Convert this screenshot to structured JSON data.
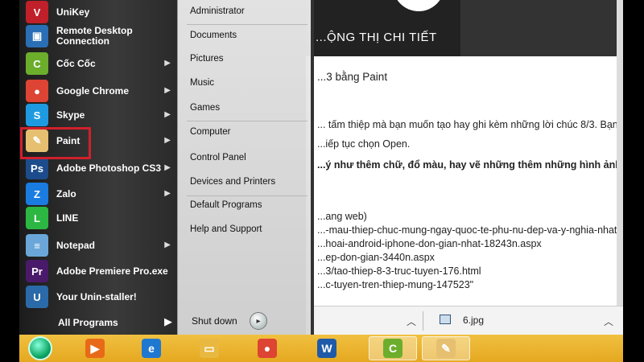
{
  "document": {
    "header_text": "...ỘNG THỊ CHI TIẾT",
    "lines": [
      "...3 bằng Paint",
      "... tấm thiệp mà bạn muốn tạo hay ghi kèm những lời chúc 8/3. Bạn",
      "...iếp tục chọn Open.",
      "...ý như thêm chữ, đổ màu, hay vẽ những thêm những hình ảnh",
      "...ang web)",
      "...-mau-thiep-chuc-mung-ngay-quoc-te-phu-nu-dep-va-y-nghia-nhat/",
      "...hoai-android-iphone-don-gian-nhat-18243n.aspx",
      "...ep-don-gian-3440n.aspx",
      "...3/tao-thiep-8-3-truc-tuyen-176.html",
      "...c-tuyen-tren-thiep-mung-147523\""
    ]
  },
  "downloads": {
    "file_name": "6.jpg"
  },
  "start_menu": {
    "programs": [
      {
        "label": "UniKey",
        "icon": "unikey-icon",
        "color": "#c0202a",
        "glyph": "V"
      },
      {
        "label": "Remote Desktop Connection",
        "icon": "remote-desktop-icon",
        "color": "#2a6fb5",
        "glyph": "▣"
      },
      {
        "label": "Cốc Cốc",
        "icon": "coccoc-icon",
        "color": "#6cae2c",
        "glyph": "C"
      },
      {
        "label": "Google Chrome",
        "icon": "chrome-icon",
        "color": "#dd4433",
        "glyph": "●"
      },
      {
        "label": "Skype",
        "icon": "skype-icon",
        "color": "#1e9be0",
        "glyph": "S"
      },
      {
        "label": "Paint",
        "icon": "paint-icon",
        "color": "#e6c070",
        "glyph": "✎"
      },
      {
        "label": "Adobe Photoshop CS3",
        "icon": "photoshop-icon",
        "color": "#1c4c8c",
        "glyph": "Ps"
      },
      {
        "label": "Zalo",
        "icon": "zalo-icon",
        "color": "#1a7ce0",
        "glyph": "Z"
      },
      {
        "label": "LINE",
        "icon": "line-icon",
        "color": "#2cb742",
        "glyph": "L"
      },
      {
        "label": "Notepad",
        "icon": "notepad-icon",
        "color": "#6aa7d8",
        "glyph": "≡"
      },
      {
        "label": "Adobe Premiere Pro.exe",
        "icon": "premiere-icon",
        "color": "#4a1a6a",
        "glyph": "Pr"
      },
      {
        "label": "Your Unin-staller!",
        "icon": "uninstaller-icon",
        "color": "#2a6aa8",
        "glyph": "U"
      }
    ],
    "all_programs": "All Programs",
    "right_items": [
      "Administrator",
      "Documents",
      "Pictures",
      "Music",
      "Games",
      "Computer",
      "Control Panel",
      "Devices and Printers",
      "Default Programs",
      "Help and Support"
    ],
    "shutdown": "Shut down"
  },
  "taskbar": {
    "items": [
      {
        "icon": "media-player-icon",
        "color": "#e86a18",
        "glyph": "▶"
      },
      {
        "icon": "internet-explorer-icon",
        "color": "#1f78d0",
        "glyph": "e"
      },
      {
        "icon": "file-explorer-icon",
        "color": "#e8b840",
        "glyph": "▭"
      },
      {
        "icon": "chrome-icon",
        "color": "#dd4433",
        "glyph": "●"
      },
      {
        "icon": "word-icon",
        "color": "#1f5aa8",
        "glyph": "W"
      },
      {
        "icon": "coccoc-icon",
        "color": "#6cae2c",
        "glyph": "C"
      },
      {
        "icon": "paint-icon",
        "color": "#e6c070",
        "glyph": "✎"
      }
    ]
  }
}
